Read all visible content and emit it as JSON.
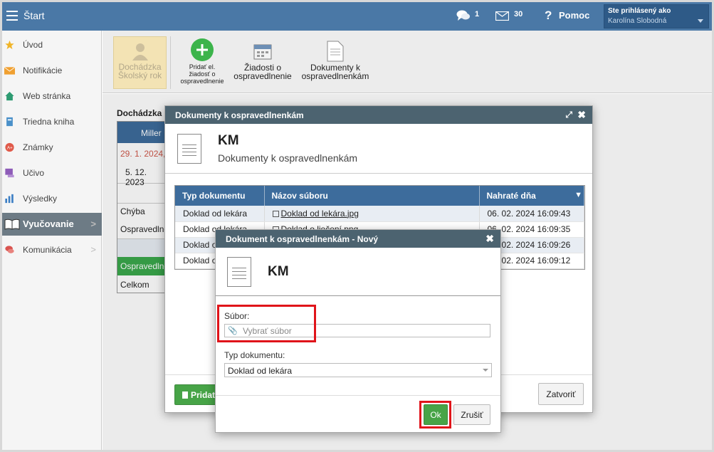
{
  "topbar": {
    "home_label": "Štart",
    "messages_count": "1",
    "mail_count": "30",
    "help_label": "Pomoc",
    "user_caption": "Ste prihlásený ako",
    "user_name": "Karolína Slobodná"
  },
  "sidebar": {
    "items": [
      {
        "label": "Úvod",
        "icon": "star-icon"
      },
      {
        "label": "Notifikácie",
        "icon": "envelope-icon"
      },
      {
        "label": "Web stránka",
        "icon": "house-icon"
      },
      {
        "label": "Triedna kniha",
        "icon": "book-icon"
      },
      {
        "label": "Známky",
        "icon": "grade-icon"
      },
      {
        "label": "Učivo",
        "icon": "monitor-icon"
      },
      {
        "label": "Výsledky",
        "icon": "bar-chart-icon"
      },
      {
        "label": "Vyučovanie",
        "icon": "open-book-icon"
      },
      {
        "label": "Komunikácia",
        "icon": "chat-icon"
      }
    ]
  },
  "toolbar": {
    "attendance_l1": "Dochádzka",
    "attendance_l2": "Školský rok",
    "add_l1": "Pridať el.",
    "add_l2": "žiadosť o",
    "add_l3": "ospravedlnenie",
    "requests_l1": "Žiadosti o",
    "requests_l2": "ospravedlnenie",
    "docs_l1": "Dokumenty k",
    "docs_l2": "ospravedlnenkám"
  },
  "background": {
    "section_title": "Dochádzka",
    "student_header": "Miller",
    "date1": "29. 1. 2024,",
    "date2": "5. 12. 2023",
    "row_absence": "Chýba",
    "row_excused": "Ospravedlne",
    "row_excused_green": "Ospravedlne",
    "row_total": "Celkom",
    "add_button": "Pridať"
  },
  "docs_dialog": {
    "title": "Dokumenty k ospravedlnenkám",
    "heading": "KM",
    "subheading": "Dokumenty k ospravedlnenkám",
    "columns": [
      "Typ dokumentu",
      "Názov súboru",
      "Nahraté dňa"
    ],
    "rows": [
      {
        "type": "Doklad od lekára",
        "file": "Doklad od lekára.jpg",
        "date": "06. 02. 2024 16:09:43"
      },
      {
        "type": "Doklad od lekára",
        "file": "Doklad o liečení.png",
        "date": "06. 02. 2024 16:09:35"
      },
      {
        "type": "Doklad od lekára",
        "file": "",
        "date": "06. 02. 2024 16:09:26"
      },
      {
        "type": "Doklad od lekára",
        "file": "",
        "date": "06. 02. 2024 16:09:12"
      }
    ],
    "close_button": "Zatvoriť"
  },
  "new_dialog": {
    "title": "Dokument k ospravedlnenkám - Nový",
    "heading": "KM",
    "file_label": "Súbor:",
    "file_placeholder": "Vybrať súbor",
    "type_label": "Typ dokumentu:",
    "type_value": "Doklad od lekára",
    "ok_button": "Ok",
    "cancel_button": "Zrušiť"
  },
  "colors": {
    "topbar": "#4a78a6",
    "dialog_header": "#4c6370",
    "table_header": "#3d6c9c",
    "highlight": "#e0141a",
    "ok_green": "#47a447"
  }
}
